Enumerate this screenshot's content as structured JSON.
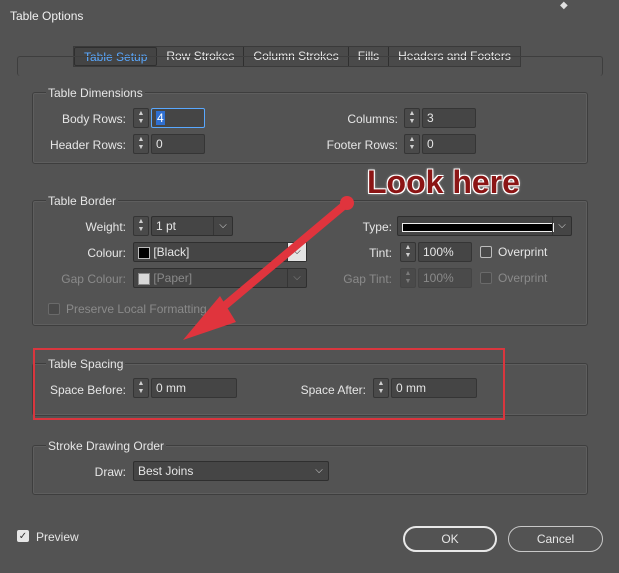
{
  "window": {
    "title": "Table Options",
    "corner_glyph": "◆"
  },
  "tabs": [
    "Table Setup",
    "Row Strokes",
    "Column Strokes",
    "Fills",
    "Headers and Footers"
  ],
  "table_dimensions": {
    "title": "Table Dimensions",
    "body_rows_label": "Body Rows:",
    "body_rows_value": "4",
    "header_rows_label": "Header Rows:",
    "header_rows_value": "0",
    "columns_label": "Columns:",
    "columns_value": "3",
    "footer_rows_label": "Footer Rows:",
    "footer_rows_value": "0"
  },
  "table_border": {
    "title": "Table Border",
    "weight_label": "Weight:",
    "weight_value": "1 pt",
    "colour_label": "Colour:",
    "colour_value": "[Black]",
    "gap_colour_label": "Gap Colour:",
    "gap_colour_value": "[Paper]",
    "type_label": "Type:",
    "tint_label": "Tint:",
    "tint_value": "100%",
    "gap_tint_label": "Gap Tint:",
    "gap_tint_value": "100%",
    "overprint_label": "Overprint",
    "gap_overprint_label": "Overprint",
    "preserve_label": "Preserve Local Formatting",
    "colors": {
      "black": "#000000",
      "paper": "#d8d8d8"
    }
  },
  "table_spacing": {
    "title": "Table Spacing",
    "space_before_label": "Space Before:",
    "space_before_value": "0 mm",
    "space_after_label": "Space After:",
    "space_after_value": "0 mm"
  },
  "stroke_order": {
    "title": "Stroke Drawing Order",
    "draw_label": "Draw:",
    "draw_value": "Best Joins"
  },
  "footer": {
    "preview_label": "Preview",
    "preview_checked": true,
    "ok_label": "OK",
    "cancel_label": "Cancel"
  },
  "annotation": {
    "text": "Look here",
    "color": "#e0343d"
  },
  "theme": {
    "accent": "#59a8ff",
    "background": "#535353"
  }
}
